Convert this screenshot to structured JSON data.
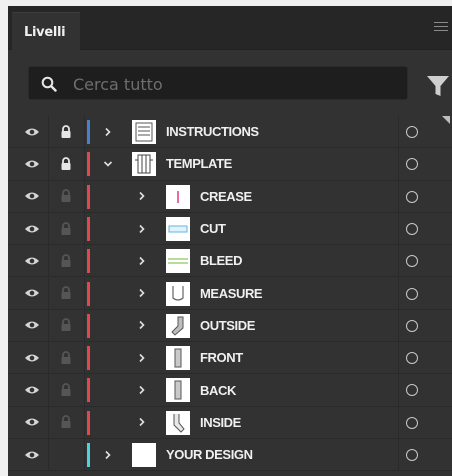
{
  "panel": {
    "tab_label": "Livelli"
  },
  "search": {
    "placeholder": "Cerca tutto"
  },
  "colors": {
    "blue": "#4a7fd0",
    "red": "#e0474f",
    "cyan": "#4ed0e0"
  },
  "layers": [
    {
      "name": "INSTRUCTIONS",
      "indent": 0,
      "expanded": false,
      "color": "blue",
      "lock": "locked",
      "thumb": "instructions"
    },
    {
      "name": "TEMPLATE",
      "indent": 0,
      "expanded": true,
      "color": "red",
      "lock": "locked",
      "thumb": "template"
    },
    {
      "name": "CREASE",
      "indent": 1,
      "expanded": false,
      "color": "red",
      "lock": "inherited",
      "thumb": "crease"
    },
    {
      "name": "CUT",
      "indent": 1,
      "expanded": false,
      "color": "red",
      "lock": "inherited",
      "thumb": "cut"
    },
    {
      "name": "BLEED",
      "indent": 1,
      "expanded": false,
      "color": "red",
      "lock": "inherited",
      "thumb": "bleed"
    },
    {
      "name": "MEASURE",
      "indent": 1,
      "expanded": false,
      "color": "red",
      "lock": "inherited",
      "thumb": "measure"
    },
    {
      "name": "OUTSIDE",
      "indent": 1,
      "expanded": false,
      "color": "red",
      "lock": "inherited",
      "thumb": "outside"
    },
    {
      "name": "FRONT",
      "indent": 1,
      "expanded": false,
      "color": "red",
      "lock": "inherited",
      "thumb": "front"
    },
    {
      "name": "BACK",
      "indent": 1,
      "expanded": false,
      "color": "red",
      "lock": "inherited",
      "thumb": "back"
    },
    {
      "name": "INSIDE",
      "indent": 1,
      "expanded": false,
      "color": "red",
      "lock": "inherited",
      "thumb": "inside"
    },
    {
      "name": "YOUR DESIGN",
      "indent": 0,
      "expanded": false,
      "color": "cyan",
      "lock": "none",
      "thumb": "blank"
    }
  ]
}
